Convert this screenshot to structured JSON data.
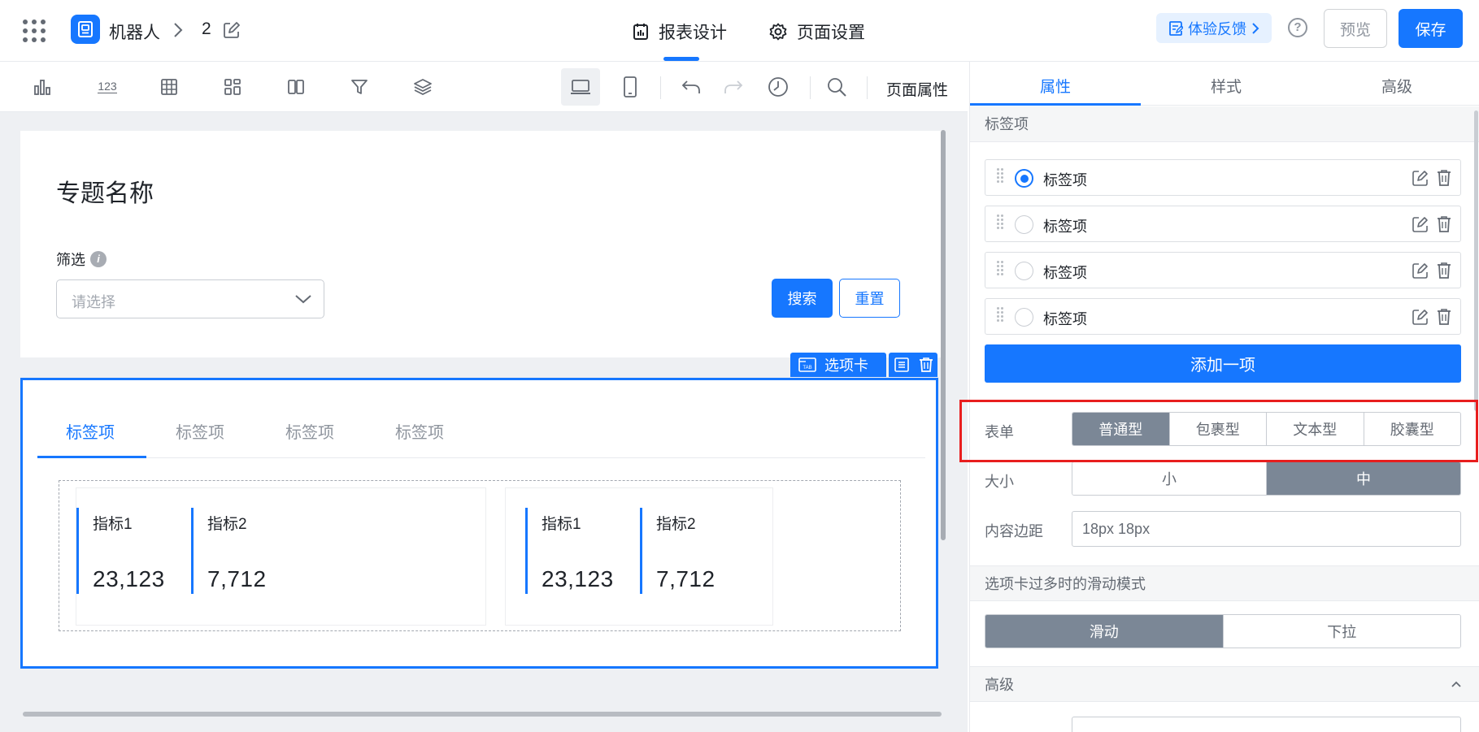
{
  "header": {
    "app_name": "机器人",
    "page_num": "2",
    "tab_report": "报表设计",
    "tab_page_settings": "页面设置",
    "feedback": "体验反馈",
    "help": "?",
    "preview": "预览",
    "save": "保存"
  },
  "toolbar": {
    "number_icon_text": "123",
    "page_attr": "页面属性"
  },
  "canvas": {
    "title": "专题名称",
    "filter_label": "筛选",
    "info": "i",
    "select_placeholder": "请选择",
    "search": "搜索",
    "reset": "重置",
    "tab_component_label": "选项卡",
    "tab_icon_text": "TAB",
    "tabs": [
      "标签项",
      "标签项",
      "标签项",
      "标签项"
    ],
    "cards": [
      {
        "metrics": [
          {
            "name": "指标1",
            "value": "23,123"
          },
          {
            "name": "指标2",
            "value": "7,712"
          }
        ]
      },
      {
        "metrics": [
          {
            "name": "指标1",
            "value": "23,123"
          },
          {
            "name": "指标2",
            "value": "7,712"
          }
        ]
      }
    ]
  },
  "panel": {
    "tabs": [
      "属性",
      "样式",
      "高级"
    ],
    "section_tags": "标签项",
    "tag_items": [
      "标签项",
      "标签项",
      "标签项",
      "标签项"
    ],
    "add_item": "添加一项",
    "form_label": "表单",
    "form_options": [
      "普通型",
      "包裹型",
      "文本型",
      "胶囊型"
    ],
    "size_label": "大小",
    "size_options": [
      "小",
      "中"
    ],
    "padding_label": "内容边距",
    "padding_value": "18px 18px",
    "scroll_mode_title": "选项卡过多时的滑动模式",
    "scroll_options": [
      "滑动",
      "下拉"
    ],
    "advanced_title": "高级"
  },
  "colors": {
    "accent": "#1677ff",
    "selected_segment": "#7b8796",
    "highlight_box": "#e81e1e"
  }
}
